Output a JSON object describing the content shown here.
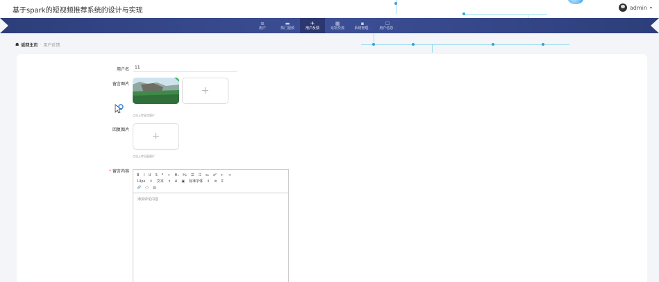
{
  "header": {
    "site_title": "基于spark的短视频推荐系统的设计与实现",
    "user": {
      "name": "admin",
      "caret": "▾",
      "icon": "user-avatar-icon"
    }
  },
  "nav": {
    "items": [
      {
        "icon": "≡",
        "icon_name": "menu-icon",
        "label": "用户",
        "active": false
      },
      {
        "icon": "▬",
        "icon_name": "video-icon",
        "label": "热门视频",
        "active": false
      },
      {
        "icon": "✈",
        "icon_name": "send-icon",
        "label": "用户反馈",
        "active": true
      },
      {
        "icon": "▦",
        "icon_name": "grid-icon",
        "label": "论坛交流",
        "active": false
      },
      {
        "icon": "▪",
        "icon_name": "system-icon",
        "label": "系统管理 ·",
        "active": false
      },
      {
        "icon": "☐",
        "icon_name": "profile-icon",
        "label": "用户信息 ·",
        "active": false
      }
    ],
    "colors": {
      "bar": "#34478a",
      "active": "#2a3770"
    }
  },
  "breadcrumb": {
    "home_icon": "☗",
    "home": "返回主页",
    "separator": "·",
    "current": "用户反馈"
  },
  "form": {
    "username": {
      "label": "用户名",
      "value": "11"
    },
    "image": {
      "label": "留言图片",
      "hint": "点击上传留言图片",
      "add_symbol": "+"
    },
    "reply_image": {
      "label": "回复图片",
      "hint": "点击上传回复图片",
      "add_symbol": "+"
    },
    "content": {
      "required_mark": "*",
      "label": "留言内容",
      "placeholder": "添加评论内容",
      "toolbar": {
        "row1": [
          "B",
          "I",
          "U",
          "S",
          "❞",
          "‹›",
          "H₁",
          "H₂",
          "☰",
          "☷",
          "x₂",
          "x²",
          "⇤",
          "⇥"
        ],
        "row2": [
          "14px",
          "⇕",
          "文本",
          "⇕",
          "A",
          "▣",
          "标准字体",
          "⇕",
          "≡",
          "T̶"
        ],
        "row3": [
          "🔗",
          "▭",
          "▤"
        ]
      }
    }
  }
}
